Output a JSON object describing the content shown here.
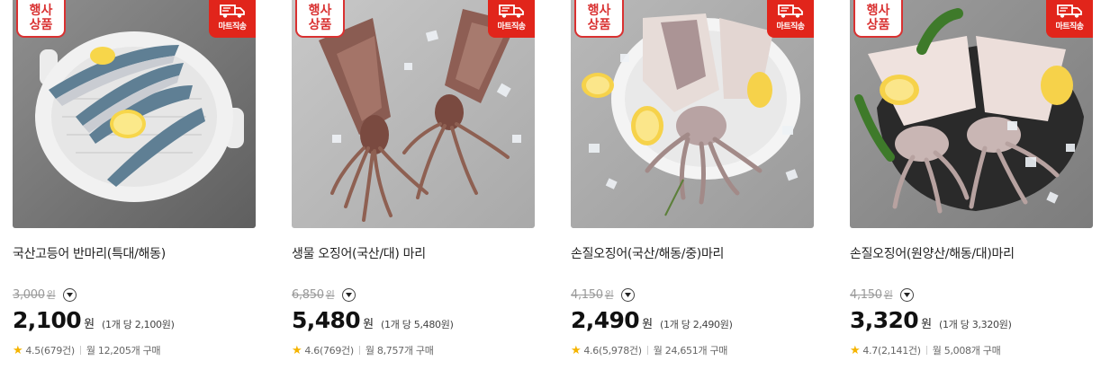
{
  "products": [
    {
      "promo_tag": "행사\n상품",
      "delivery_badge": "마트직송",
      "image_subject": "mackerel",
      "title": "국산고등어 반마리(특대/해동)",
      "original_price": "3,000",
      "original_won": "원",
      "price": "2,100",
      "price_won": "원",
      "unit_price": "(1개 당 2,100원)",
      "rating": "4.5(679건)",
      "monthly_sales": "월 12,205개 구매"
    },
    {
      "promo_tag": "행사\n상품",
      "delivery_badge": "마트직송",
      "image_subject": "squid-raw",
      "title": "생물 오징어(국산/대) 마리",
      "original_price": "6,850",
      "original_won": "원",
      "price": "5,480",
      "price_won": "원",
      "unit_price": "(1개 당 5,480원)",
      "rating": "4.6(769건)",
      "monthly_sales": "월 8,757개 구매"
    },
    {
      "promo_tag": "행사\n상품",
      "delivery_badge": "마트직송",
      "image_subject": "squid-plate",
      "title": "손질오징어(국산/해동/중)마리",
      "original_price": "4,150",
      "original_won": "원",
      "price": "2,490",
      "price_won": "원",
      "unit_price": "(1개 당 2,490원)",
      "rating": "4.6(5,978건)",
      "monthly_sales": "월 24,651개 구매"
    },
    {
      "promo_tag": "행사\n상품",
      "delivery_badge": "마트직송",
      "image_subject": "squid-slate",
      "title": "손질오징어(원양산/해동/대)마리",
      "original_price": "4,150",
      "original_won": "원",
      "price": "3,320",
      "price_won": "원",
      "unit_price": "(1개 당 3,320원)",
      "rating": "4.7(2,141건)",
      "monthly_sales": "월 5,008개 구매"
    }
  ],
  "colors": {
    "accent_red": "#e1251b",
    "tag_red": "#d93131",
    "star": "#f5b400"
  },
  "icons": {
    "delivery": "truck-icon",
    "info": "chevron-down-icon",
    "rating": "star-icon"
  }
}
